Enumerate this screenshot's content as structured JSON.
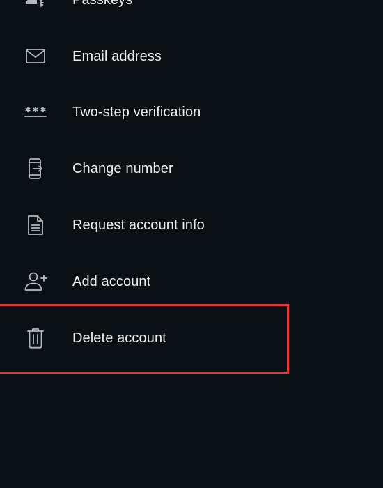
{
  "menu": {
    "items": [
      {
        "label": "Passkeys",
        "icon": "passkey-icon"
      },
      {
        "label": "Email address",
        "icon": "envelope-icon"
      },
      {
        "label": "Two-step verification",
        "icon": "asterisk-password-icon"
      },
      {
        "label": "Change number",
        "icon": "phone-transfer-icon"
      },
      {
        "label": "Request account info",
        "icon": "document-icon"
      },
      {
        "label": "Add account",
        "icon": "add-person-icon"
      },
      {
        "label": "Delete account",
        "icon": "trash-icon"
      }
    ]
  },
  "colors": {
    "background": "#0b1014",
    "text": "#e9edef",
    "icon": "#aebac1",
    "highlight": "#e0393a"
  }
}
